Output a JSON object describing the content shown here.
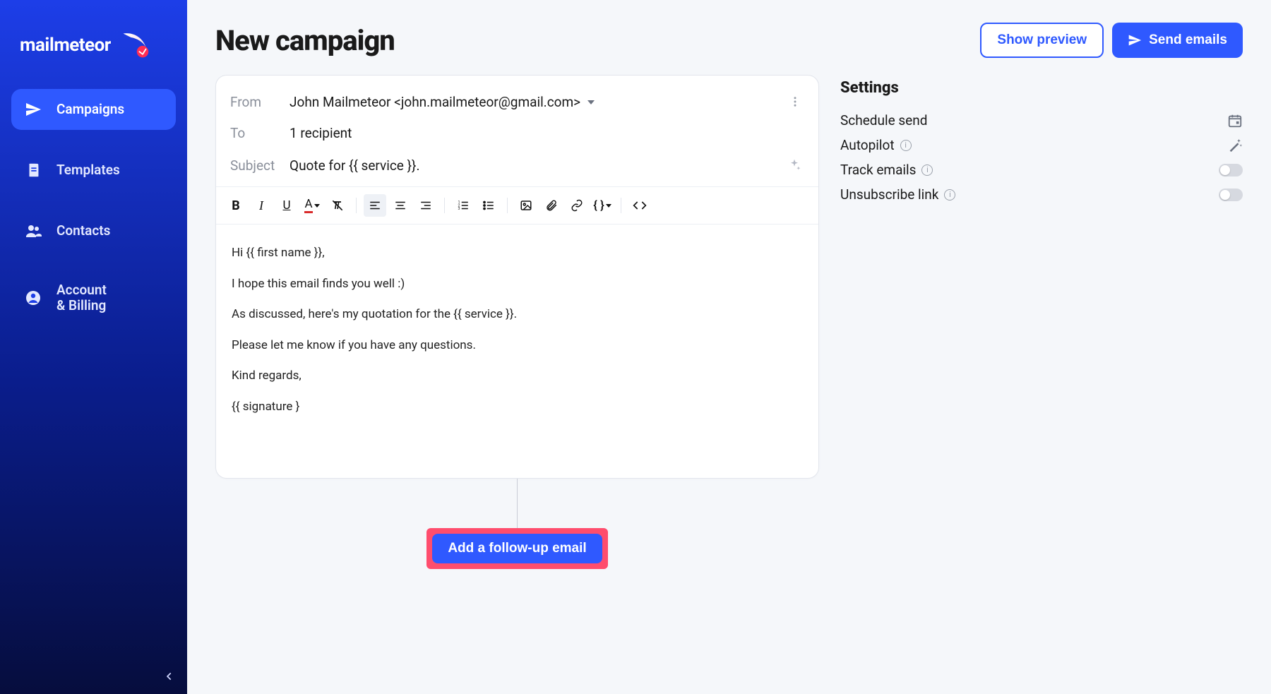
{
  "brand": {
    "name": "mailmeteor"
  },
  "sidebar": {
    "items": [
      {
        "label": "Campaigns"
      },
      {
        "label": "Templates"
      },
      {
        "label": "Contacts"
      },
      {
        "label": "Account\n& Billing"
      }
    ]
  },
  "header": {
    "title": "New campaign",
    "preview_button": "Show preview",
    "send_button": "Send emails"
  },
  "compose": {
    "from_label": "From",
    "from_value": "John Mailmeteor <john.mailmeteor@gmail.com>",
    "to_label": "To",
    "to_value": "1 recipient",
    "subject_label": "Subject",
    "subject_value": "Quote for {{ service }}.",
    "body_lines": [
      "Hi {{ first name }},",
      "I hope this email finds you well :)",
      "As discussed, here's my quotation for the {{ service }}.",
      "Please let me know if you have any questions.",
      "Kind regards,",
      "{{ signature }"
    ]
  },
  "followup": {
    "button": "Add a follow-up email"
  },
  "settings": {
    "heading": "Settings",
    "rows": [
      {
        "label": "Schedule send",
        "control": "calendar"
      },
      {
        "label": "Autopilot",
        "info": true,
        "control": "wand"
      },
      {
        "label": "Track emails",
        "info": true,
        "control": "toggle"
      },
      {
        "label": "Unsubscribe link",
        "info": true,
        "control": "toggle"
      }
    ]
  }
}
